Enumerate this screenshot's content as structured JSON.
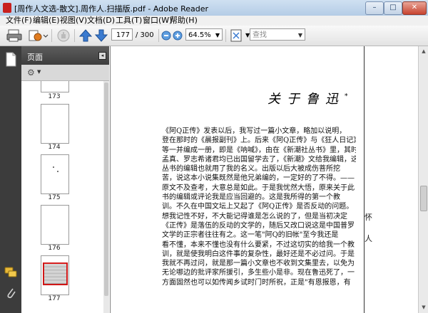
{
  "window": {
    "title": "[周作人文选-散文].周作人.扫描版.pdf - Adobe Reader",
    "min": "–",
    "max": "□",
    "close": "✕"
  },
  "menu": [
    "文件(F)",
    "编辑(E)",
    "视图(V)",
    "文档(D)",
    "工具(T)",
    "窗口(W)",
    "帮助(H)"
  ],
  "toolbar": {
    "page_current": "177",
    "page_total": "/ 300",
    "zoom": "64.5%",
    "search_placeholder": "查找"
  },
  "panel": {
    "title": "页面",
    "thumbnails": [
      {
        "label": "173"
      },
      {
        "label": "174"
      },
      {
        "label": "175"
      },
      {
        "label": "176"
      },
      {
        "label": "177",
        "selected": true
      }
    ]
  },
  "document": {
    "heading": "关于鲁迅",
    "paragraph_lines": [
      "《阿Q正传》发表以后，我写过一篇小文章，略加以说明，",
      "登在那时的《晨报副刊》上。后来《阿Q正传》与《狂人日记》",
      "等一并编成一册，即是《呐喊》，由在《新潮社丛书》里，其时傅",
      "孟真、罗志希诸君均已出国留学去了，《新潮》文给我编辑，这",
      "丛书的编辑也就用了我的名义。出版以后大被成伤菩所挖",
      "苦，说这本小说集既然是他兄弟编的，一定好的了不得。——",
      "原文不及查考，大意总是如此。于是我忧然大悟，原来关于此",
      "书的编辑或评论我是应当回避的。这是我所得的第一个教",
      "训。不久在中国文坛上又起了《阿Q正传》是否反动的问题。",
      "想我记性不好，不大能记得谁是怎么说的了，但是当初决定",
      "《正传》是落伍的反动的文学的，随后又改口说这是中国普罗",
      "文学的正宗者往往有之。这一笔\"阿Q的旧帐\"至今我还是",
      "看不懂，本来不懂也没有什么要紧，不过这切实的给我一个教",
      "训，就是使我明白这件事的复杂性，最好还是不必过问。于是",
      "我就不再过问，就是那一篇小文章也不收到文集里去，以免为",
      "无论哪边的批评家所援引，多生些小是非。现在鲁迅死了，一",
      "方面固然也可以如传闻乡试时门时所祝，正是\"有恩报恩，有"
    ],
    "spine_glyphs": [
      "怀",
      "人"
    ]
  }
}
